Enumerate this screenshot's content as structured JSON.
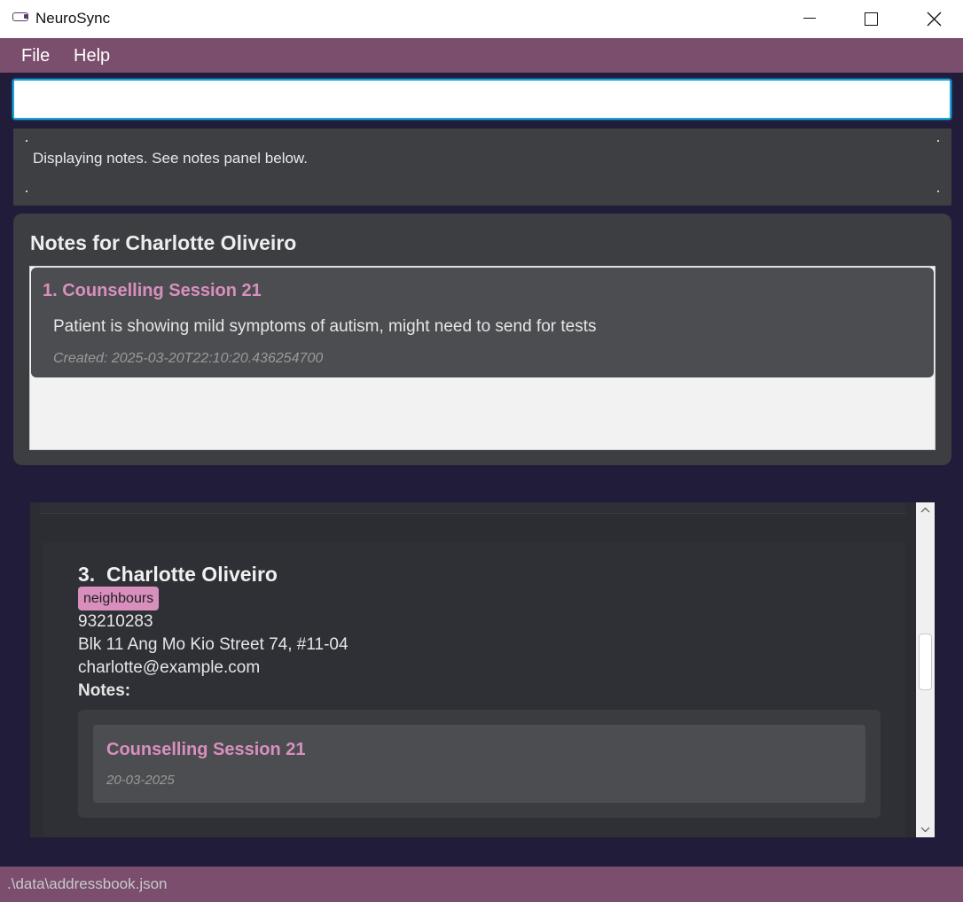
{
  "window": {
    "title": "NeuroSync",
    "icon": "app-icon"
  },
  "menu": {
    "items": [
      {
        "label": "File"
      },
      {
        "label": "Help"
      }
    ]
  },
  "command": {
    "value": "",
    "placeholder": ""
  },
  "result": {
    "message": "Displaying notes. See notes panel below."
  },
  "notes_panel": {
    "title": "Notes for Charlotte Oliveiro",
    "notes": [
      {
        "title": "1. Counselling Session 21",
        "content": "Patient is showing mild symptoms of autism, might need to send for tests",
        "created": "Created: 2025-03-20T22:10:20.436254700"
      }
    ]
  },
  "person_list": {
    "persons": [
      {
        "name": "3.  Charlotte Oliveiro",
        "tags": [
          "neighbours"
        ],
        "phone": "93210283",
        "address": "Blk 11 Ang Mo Kio Street 74, #11-04",
        "email": "charlotte@example.com",
        "notes_label": "Notes:",
        "notes": [
          {
            "title": "Counselling Session 21",
            "date": "20-03-2025"
          }
        ]
      }
    ]
  },
  "status": {
    "file_path": ".\\data\\addressbook.json"
  },
  "colors": {
    "accent": "#7b4e6e",
    "tag": "#d98fbe",
    "background": "#201c3a",
    "focus": "#1aa4de"
  }
}
